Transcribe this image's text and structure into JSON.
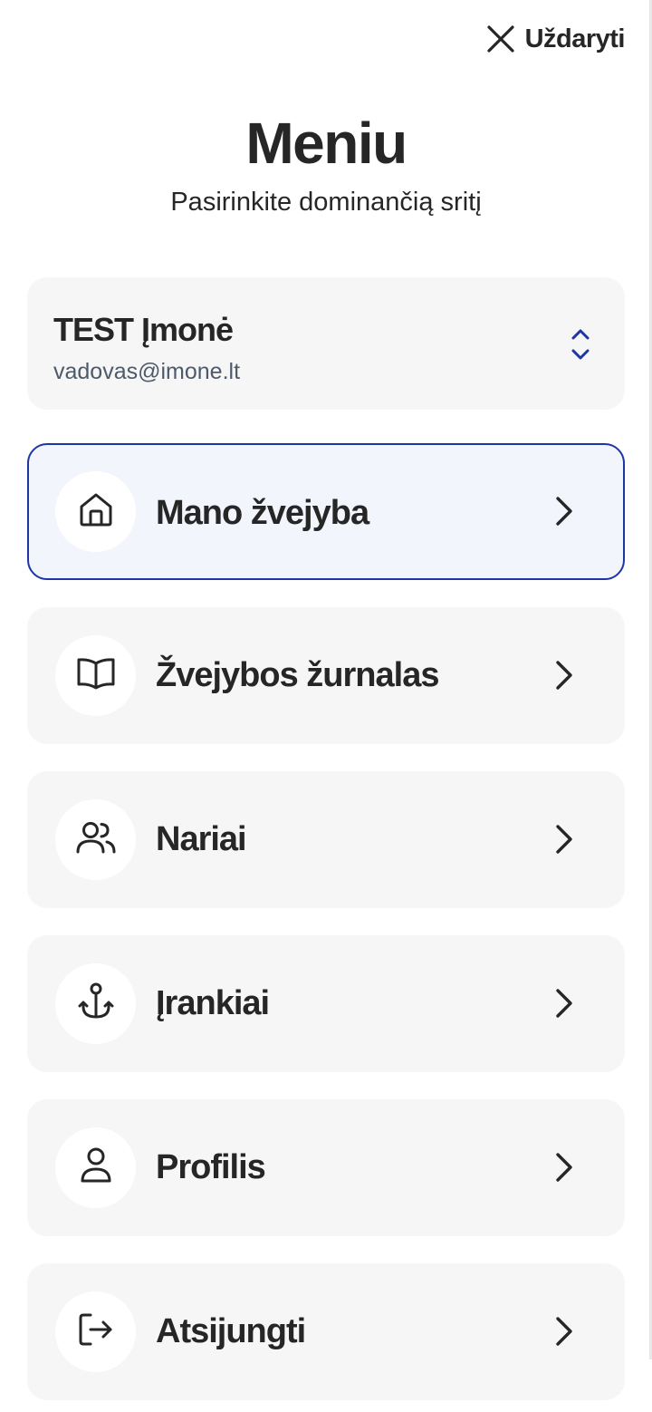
{
  "header": {
    "close_label": "Uždaryti",
    "title": "Meniu",
    "subtitle": "Pasirinkite dominančią sritį"
  },
  "company": {
    "name": "TEST Įmonė",
    "email": "vadovas@imone.lt"
  },
  "menu": {
    "items": [
      {
        "label": "Mano žvejyba",
        "icon": "home-icon",
        "active": true
      },
      {
        "label": "Žvejybos žurnalas",
        "icon": "book-icon",
        "active": false
      },
      {
        "label": "Nariai",
        "icon": "users-icon",
        "active": false
      },
      {
        "label": "Įrankiai",
        "icon": "anchor-icon",
        "active": false
      },
      {
        "label": "Profilis",
        "icon": "user-icon",
        "active": false
      },
      {
        "label": "Atsijungti",
        "icon": "logout-icon",
        "active": false
      }
    ]
  },
  "colors": {
    "accent": "#1d36a6",
    "card_bg": "#f6f6f6",
    "active_bg": "#f3f5fd",
    "text": "#262626",
    "muted": "#4d5a6b"
  }
}
